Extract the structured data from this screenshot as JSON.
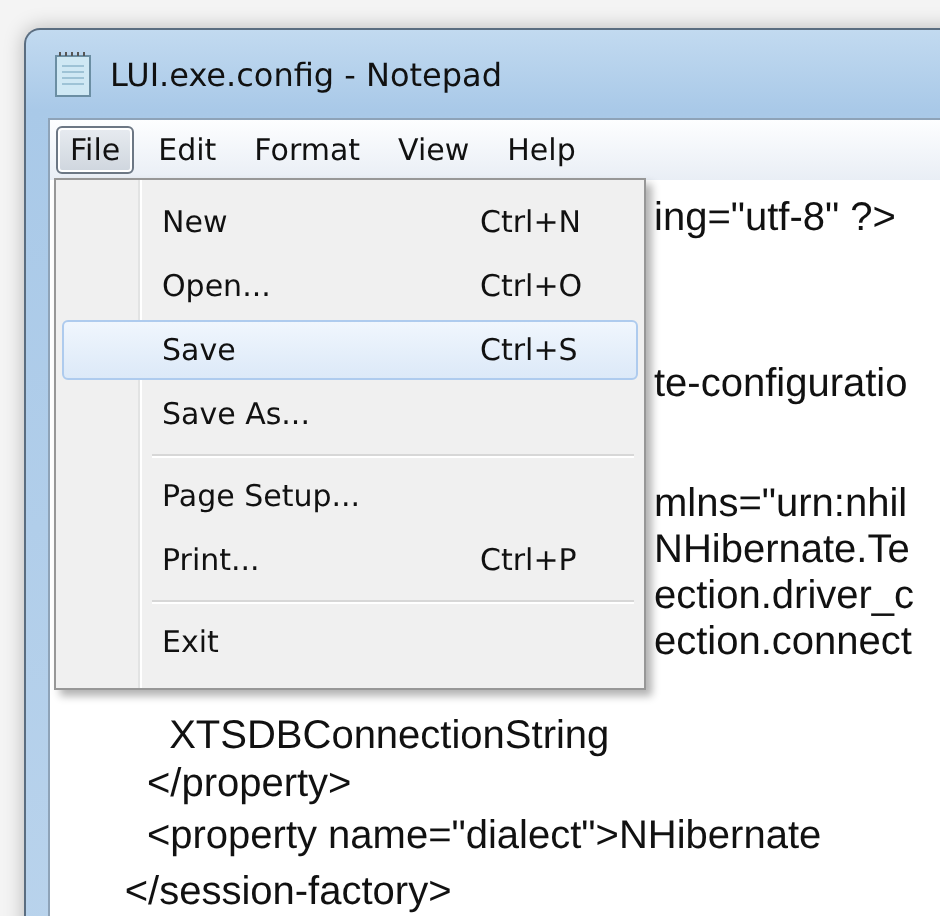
{
  "window": {
    "title": "LUI.exe.config - Notepad"
  },
  "menubar": [
    {
      "label": "File",
      "selected": true
    },
    {
      "label": "Edit",
      "selected": false
    },
    {
      "label": "Format",
      "selected": false
    },
    {
      "label": "View",
      "selected": false
    },
    {
      "label": "Help",
      "selected": false
    }
  ],
  "file_menu": [
    {
      "kind": "item",
      "label": "New",
      "shortcut": "Ctrl+N",
      "selected": false
    },
    {
      "kind": "item",
      "label": "Open...",
      "shortcut": "Ctrl+O",
      "selected": false
    },
    {
      "kind": "item",
      "label": "Save",
      "shortcut": "Ctrl+S",
      "selected": true
    },
    {
      "kind": "item",
      "label": "Save As...",
      "selected": false
    },
    {
      "kind": "separator"
    },
    {
      "kind": "item",
      "label": "Page Setup...",
      "selected": false
    },
    {
      "kind": "item",
      "label": "Print...",
      "shortcut": "Ctrl+P",
      "selected": false
    },
    {
      "kind": "separator"
    },
    {
      "kind": "item",
      "label": "Exit",
      "selected": false
    }
  ],
  "editor_lines": [
    {
      "kind": "behind_menu",
      "text": "ing=\"utf-8\" ?>"
    },
    {
      "kind": "behind_menu",
      "text": "te-configuratio"
    },
    {
      "kind": "behind_menu",
      "text": "mlns=\"urn:nhil"
    },
    {
      "kind": "behind_menu",
      "text": "NHibernate.Te"
    },
    {
      "kind": "behind_menu",
      "text": "ection.driver_c"
    },
    {
      "kind": "behind_menu",
      "text": "ection.connect"
    },
    {
      "kind": "full",
      "text": "          XTSDBConnectionString"
    },
    {
      "kind": "full",
      "text": "        </property>"
    },
    {
      "kind": "full",
      "text": "        <property name=\"dialect\">NHibernate"
    },
    {
      "kind": "full",
      "text": "      </session-factory>"
    }
  ]
}
